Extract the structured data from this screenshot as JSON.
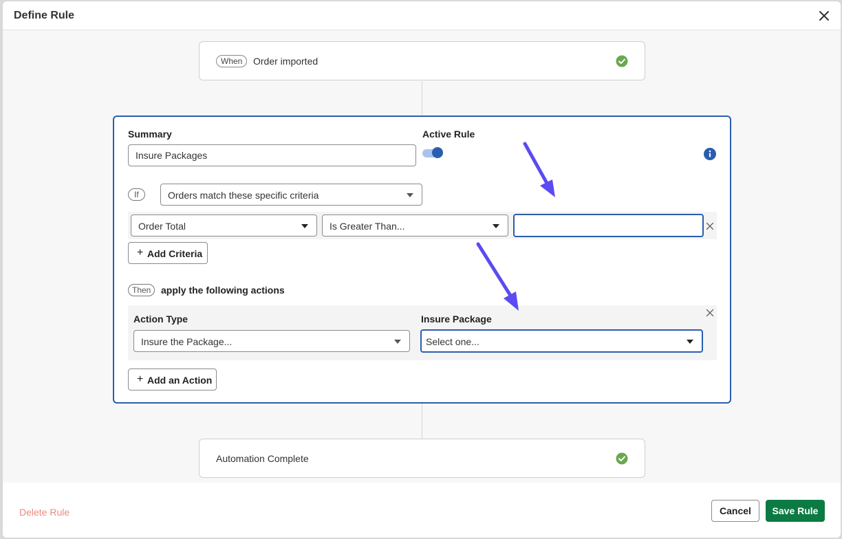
{
  "modal": {
    "title": "Define Rule"
  },
  "trigger": {
    "when_label": "When",
    "event": "Order imported"
  },
  "rule": {
    "summary_label": "Summary",
    "summary_value": "Insure Packages",
    "active_label": "Active Rule",
    "active": true,
    "if_label": "If",
    "condition_mode": "Orders match these specific criteria",
    "criteria": [
      {
        "field": "Order Total",
        "operator": "Is Greater Than...",
        "value": ""
      }
    ],
    "add_criteria_label": "Add Criteria",
    "then_label": "Then",
    "then_text": "apply the following actions",
    "actions": [
      {
        "type_label": "Action Type",
        "type_value": "Insure the Package...",
        "param_label": "Insure Package",
        "param_value": "Select one..."
      }
    ],
    "add_action_label": "Add an Action"
  },
  "completion": {
    "text": "Automation Complete"
  },
  "footer": {
    "delete_label": "Delete Rule",
    "cancel_label": "Cancel",
    "save_label": "Save Rule"
  },
  "colors": {
    "accent": "#2a5db0",
    "success": "#6aa84f",
    "save_button": "#0c7a43",
    "delete_link": "#e88b7e",
    "annotation_arrow": "#5b4bf0"
  }
}
